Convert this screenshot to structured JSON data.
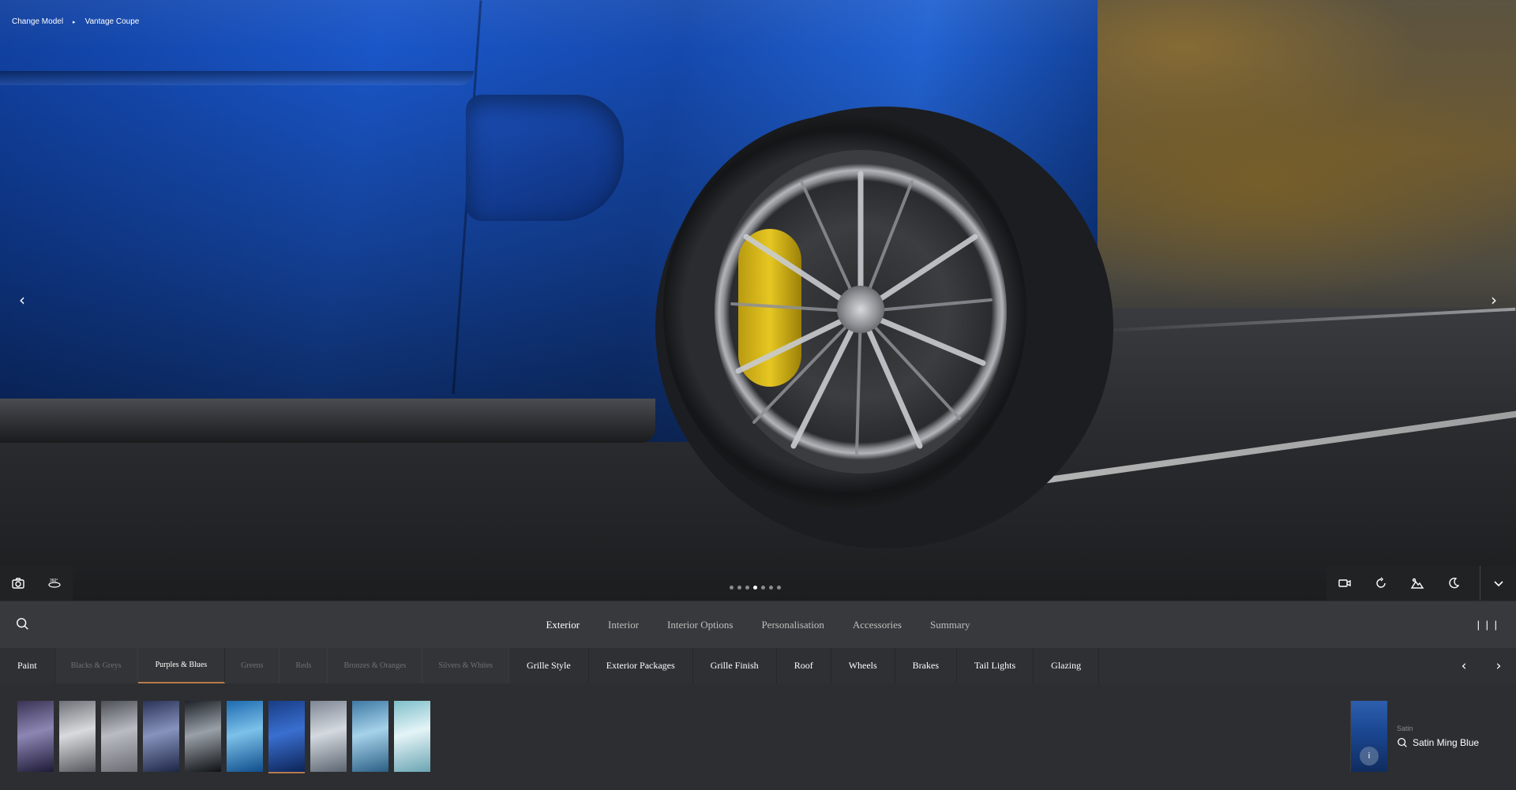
{
  "breadcrumb": {
    "change_model": "Change Model",
    "separator": "▸",
    "model": "Vantage Coupe"
  },
  "hero": {
    "prev_icon": "chevron-left-icon",
    "next_icon": "chevron-right-icon",
    "tools_left": [
      "camera-icon",
      "360-view-icon"
    ],
    "tools_right": [
      "video-camera-icon",
      "rotate-icon",
      "environment-icon",
      "night-mode-icon",
      "chevron-down-icon"
    ],
    "dots_count": 7,
    "active_dot_index": 3,
    "label_360": "360°"
  },
  "nav": {
    "tabs": [
      "Exterior",
      "Interior",
      "Interior Options",
      "Personalisation",
      "Accessories",
      "Summary"
    ],
    "active_tab": "Exterior",
    "menu_label": "| | |"
  },
  "subnav": {
    "paint": "Paint",
    "palettes": [
      "Blacks & Greys",
      "Purples & Blues",
      "Greens",
      "Reds",
      "Bronzes & Oranges",
      "Silvers & Whites"
    ],
    "active_palette": "Purples & Blues",
    "categories": [
      "Grille Style",
      "Exterior Packages",
      "Grille Finish",
      "Roof",
      "Wheels",
      "Brakes",
      "Tail Lights",
      "Glazing"
    ]
  },
  "swatches": {
    "colors": [
      [
        "#3a3354",
        "#8d86b4",
        "#1e1a36"
      ],
      [
        "#6e7178",
        "#d9dadd",
        "#55585e"
      ],
      [
        "#4d5057",
        "#b9bcc2",
        "#6a6d73"
      ],
      [
        "#2b3358",
        "#8793bd",
        "#1d2645"
      ],
      [
        "#1d2228",
        "#9aa0a8",
        "#0e1114"
      ],
      [
        "#1d6ab0",
        "#7cc1ea",
        "#0f4e8c"
      ],
      [
        "#183d86",
        "#3a6fd0",
        "#0d2457"
      ],
      [
        "#7d8693",
        "#d4d9df",
        "#5b6571"
      ],
      [
        "#3e79a4",
        "#a6d2ea",
        "#2a5f85"
      ],
      [
        "#7fbfc9",
        "#e4f4f7",
        "#6aa5b3"
      ]
    ],
    "selected_index": 6
  },
  "selection": {
    "finish": "Satin",
    "name": "Satin Ming Blue",
    "info_label": "i"
  }
}
